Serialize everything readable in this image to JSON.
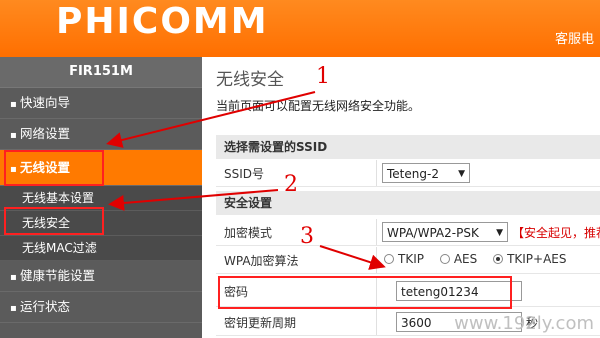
{
  "header": {
    "logo": "PHICOMM",
    "right_link": "客服电"
  },
  "sidebar": {
    "model": "FIR151M",
    "items": [
      {
        "label": "快速向导"
      },
      {
        "label": "网络设置"
      },
      {
        "label": "无线设置"
      },
      {
        "label": "无线基本设置"
      },
      {
        "label": "无线安全"
      },
      {
        "label": "无线MAC过滤"
      },
      {
        "label": "健康节能设置"
      },
      {
        "label": "运行状态"
      }
    ]
  },
  "main": {
    "title": "无线安全",
    "description": "当前页面可以配置无线网络安全功能。",
    "ssid_section": "选择需设置的SSID",
    "ssid_label": "SSID号",
    "ssid_value": "Teteng-2",
    "security_section": "安全设置",
    "encrypt_label": "加密模式",
    "encrypt_value": "WPA/WPA2-PSK",
    "encrypt_note": "【安全起见，推荐",
    "algo_label": "WPA加密算法",
    "algo_options": [
      "TKIP",
      "AES",
      "TKIP+AES"
    ],
    "algo_selected": "TKIP+AES",
    "password_label": "密码",
    "password_value": "teteng01234",
    "renew_label": "密钥更新周期",
    "renew_value": "3600",
    "renew_unit": "秒"
  },
  "annotations": [
    "1",
    "2",
    "3"
  ],
  "watermark": "www.192ly.com"
}
